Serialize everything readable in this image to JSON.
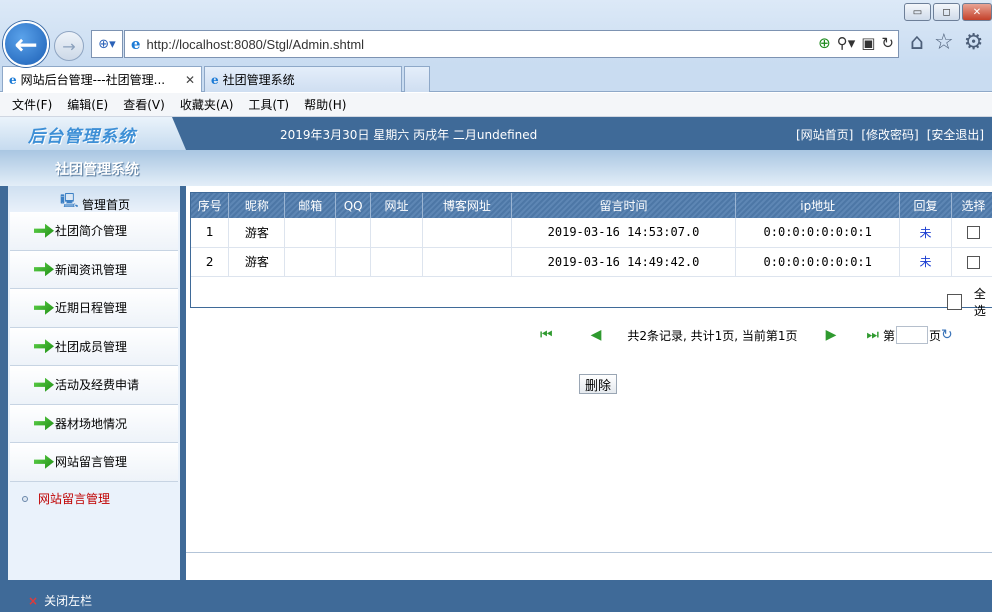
{
  "browser": {
    "url": "http://localhost:8080/Stgl/Admin.shtml",
    "tabs": [
      {
        "label": "网站后台管理---社团管理...",
        "active": true
      },
      {
        "label": "社团管理系统",
        "active": false
      }
    ],
    "menu": [
      "文件(F)",
      "编辑(E)",
      "查看(V)",
      "收藏夹(A)",
      "工具(T)",
      "帮助(H)"
    ],
    "window_controls": {
      "minimize": "▭",
      "restore": "◻",
      "close": "✕"
    }
  },
  "header": {
    "logo": "后台管理系统",
    "date": "2019年3月30日  星期六  丙戌年  二月undefined",
    "links": [
      "[网站首页]",
      "[修改密码]",
      "[安全退出]"
    ],
    "subtitle": "社团管理系统"
  },
  "sidebar": {
    "home": "管理首页",
    "items": [
      {
        "label": "社团简介管理"
      },
      {
        "label": "新闻资讯管理"
      },
      {
        "label": "近期日程管理"
      },
      {
        "label": "社团成员管理"
      },
      {
        "label": "活动及经费申请"
      },
      {
        "label": "器材场地情况"
      },
      {
        "label": "网站留言管理"
      }
    ],
    "sub_link": "网站留言管理",
    "close_left": "关闭左栏"
  },
  "table": {
    "columns": [
      "序号",
      "昵称",
      "邮箱",
      "QQ",
      "网址",
      "博客网址",
      "留言时间",
      "ip地址",
      "回复",
      "选择"
    ],
    "rows": [
      {
        "no": "1",
        "nick": "游客",
        "email": "",
        "qq": "",
        "site": "",
        "blog": "",
        "time": "2019-03-16 14:53:07.0",
        "ip": "0:0:0:0:0:0:0:1",
        "reply": "未"
      },
      {
        "no": "2",
        "nick": "游客",
        "email": "",
        "qq": "",
        "site": "",
        "blog": "",
        "time": "2019-03-16 14:49:42.0",
        "ip": "0:0:0:0:0:0:0:1",
        "reply": "未"
      }
    ],
    "select_all": "全选"
  },
  "pager": {
    "summary": "共2条记录, 共计1页, 当前第1页",
    "page_prefix": "第",
    "page_suffix": "页"
  },
  "delete_button": "删除"
}
